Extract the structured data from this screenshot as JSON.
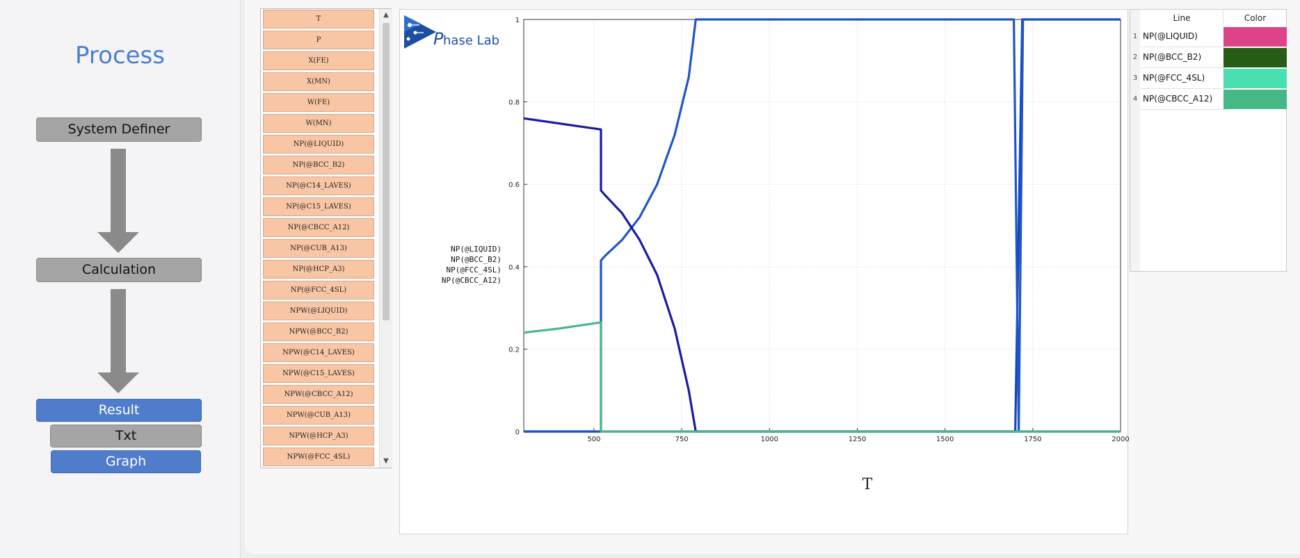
{
  "process_panel": {
    "title": "Process",
    "buttons": {
      "system_definer": "System Definer",
      "calculation": "Calculation",
      "result": "Result",
      "txt": "Txt",
      "graph": "Graph"
    }
  },
  "variables": [
    "T",
    "P",
    "X(FE)",
    "X(MN)",
    "W(FE)",
    "W(MN)",
    "NP(@LIQUID)",
    "NP(@BCC_B2)",
    "NP(@C14_LAVES)",
    "NP(@C15_LAVES)",
    "NP(@CBCC_A12)",
    "NP(@CUB_A13)",
    "NP(@HCP_A3)",
    "NP(@FCC_4SL)",
    "NPW(@LIQUID)",
    "NPW(@BCC_B2)",
    "NPW(@C14_LAVES)",
    "NPW(@C15_LAVES)",
    "NPW(@CBCC_A12)",
    "NPW(@CUB_A13)",
    "NPW(@HCP_A3)",
    "NPW(@FCC_4SL)"
  ],
  "logo": {
    "text_p": "P",
    "text_rest": "hase Lab"
  },
  "legend_table": {
    "headers": {
      "line": "Line",
      "color": "Color"
    },
    "rows": [
      {
        "num": "1",
        "name": "NP(@LIQUID)",
        "color": "#de4288"
      },
      {
        "num": "2",
        "name": "NP(@BCC_B2)",
        "color": "#275c17"
      },
      {
        "num": "3",
        "name": "NP(@FCC_4SL)",
        "color": "#48e0b0"
      },
      {
        "num": "4",
        "name": "NP(@CBCC_A12)",
        "color": "#46b886"
      }
    ]
  },
  "chart_data": {
    "type": "line",
    "xlabel": "T",
    "ylabel": "",
    "xlim": [
      300,
      2000
    ],
    "ylim": [
      0,
      1
    ],
    "x_ticks": [
      500,
      750,
      1000,
      1250,
      1500,
      1750,
      2000
    ],
    "y_ticks": [
      0,
      0.2,
      0.4,
      0.6,
      0.8,
      1
    ],
    "x_tick_labels": [
      "500",
      "750",
      "1000",
      "1250",
      "1500",
      "1750",
      "2000"
    ],
    "y_tick_labels": [
      "0",
      "0.2",
      "0.4",
      "0.6",
      "0.8",
      "1"
    ],
    "grid": true,
    "legend_labels": [
      "NP(@LIQUID)",
      "NP(@BCC_B2)",
      "NP(@FCC_4SL)",
      "NP(@CBCC_A12)"
    ],
    "series": [
      {
        "name": "NP(@LIQUID)",
        "color": "#1346c0",
        "x": [
          300,
          1697,
          1700,
          1720,
          1722,
          1735,
          2000
        ],
        "y": [
          0,
          0,
          0,
          1,
          1,
          1,
          1
        ]
      },
      {
        "name": "NP(@BCC_B2)",
        "color": "#1e55c8",
        "x": [
          300,
          520,
          520,
          530,
          580,
          630,
          680,
          730,
          770,
          790,
          800,
          1695,
          1696,
          1710,
          1722,
          1735,
          2000
        ],
        "y": [
          0,
          0,
          0.415,
          0.425,
          0.465,
          0.52,
          0.6,
          0.72,
          0.86,
          1.0,
          1.0,
          1.0,
          1.0,
          0,
          1.0,
          1.0,
          1.0
        ]
      },
      {
        "name": "NP(@FCC_4SL)",
        "color": "#1a1aa0",
        "x": [
          300,
          520,
          520,
          530,
          580,
          630,
          680,
          730,
          770,
          790,
          2000
        ],
        "y": [
          0.76,
          0.733,
          0.585,
          0.575,
          0.53,
          0.465,
          0.38,
          0.25,
          0.1,
          0,
          0
        ]
      },
      {
        "name": "NP(@CBCC_A12)",
        "color": "#48b888",
        "x": [
          300,
          400,
          520,
          520,
          2000
        ],
        "y": [
          0.24,
          0.25,
          0.265,
          0,
          0
        ]
      }
    ]
  }
}
